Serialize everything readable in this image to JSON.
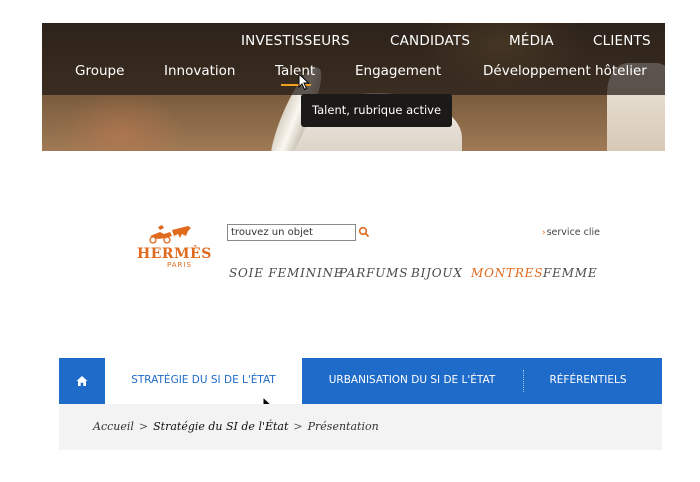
{
  "hotel_site": {
    "top_nav": [
      {
        "label": "INVESTISSEURS"
      },
      {
        "label": "CANDIDATS"
      },
      {
        "label": "MÉDIA"
      },
      {
        "label": "CLIENTS"
      }
    ],
    "main_nav": [
      {
        "label": "Groupe"
      },
      {
        "label": "Innovation"
      },
      {
        "label": "Talent",
        "active": true
      },
      {
        "label": "Engagement"
      },
      {
        "label": "Développement hôtelier"
      }
    ],
    "accent_color": "#f0a020",
    "tooltip": "Talent, rubrique active"
  },
  "hermes": {
    "logo_text": "HERMÈS",
    "logo_subtext": "PARIS",
    "search_placeholder": "trouvez un objet",
    "search_icon": "magnifier-icon",
    "service_link": "service clie",
    "categories": [
      {
        "label": "SOIE FEMININE"
      },
      {
        "label": "PARFUMS"
      },
      {
        "label": "BIJOUX"
      },
      {
        "label": "MONTRES",
        "active": true
      },
      {
        "label": "FEMME"
      }
    ],
    "accent_color": "#e06a1e"
  },
  "si_etat": {
    "home_icon": "home-icon",
    "tabs": [
      {
        "label": "STRATÉGIE DU SI DE L'ÉTAT",
        "active": true
      },
      {
        "label": "URBANISATION DU SI DE L'ÉTAT"
      },
      {
        "label": "RÉFÉRENTIELS"
      }
    ],
    "brand_color": "#1f6bc9",
    "breadcrumb": {
      "home": "Accueil",
      "section": "Stratégie du SI de l'État",
      "current": "Présentation",
      "separator": ">"
    }
  }
}
